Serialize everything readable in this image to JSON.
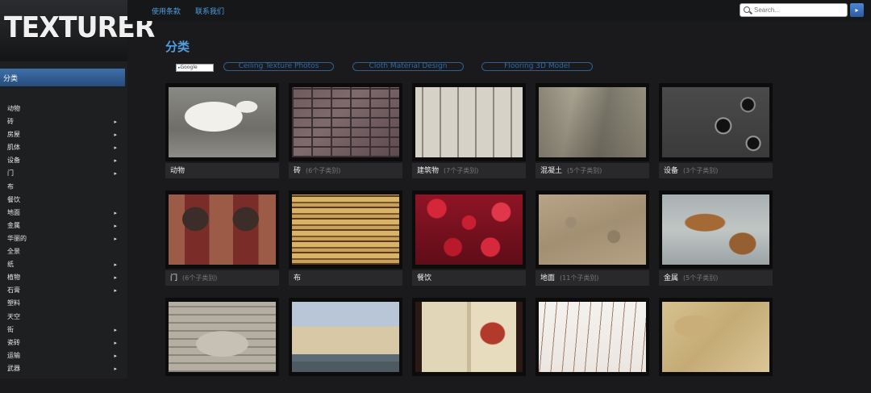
{
  "logo": {
    "text": "TEXTURER"
  },
  "topbar": {
    "links": [
      "使用条款",
      "联系我们"
    ],
    "search_placeholder": "Search..."
  },
  "sidebar": {
    "active": "分类",
    "items": [
      {
        "label": "动物",
        "arrow": false
      },
      {
        "label": "砖",
        "arrow": true
      },
      {
        "label": "房屋",
        "arrow": true
      },
      {
        "label": "肌体",
        "arrow": true
      },
      {
        "label": "设备",
        "arrow": true
      },
      {
        "label": "门",
        "arrow": true
      },
      {
        "label": "布",
        "arrow": false
      },
      {
        "label": "餐饮",
        "arrow": false
      },
      {
        "label": "地面",
        "arrow": true
      },
      {
        "label": "金属",
        "arrow": true
      },
      {
        "label": "华丽的",
        "arrow": true
      },
      {
        "label": "全景",
        "arrow": false
      },
      {
        "label": "纸",
        "arrow": true
      },
      {
        "label": "植物",
        "arrow": true
      },
      {
        "label": "石膏",
        "arrow": true
      },
      {
        "label": "塑料",
        "arrow": false
      },
      {
        "label": "天空",
        "arrow": false
      },
      {
        "label": "街",
        "arrow": true
      },
      {
        "label": "瓷砖",
        "arrow": true
      },
      {
        "label": "运输",
        "arrow": true
      },
      {
        "label": "武器",
        "arrow": true
      }
    ]
  },
  "main": {
    "title": "分类",
    "google_badge": "Google",
    "ad_pills": [
      "Ceiling Texture Photos",
      "Cloth Material Design",
      "Flooring 3D Model"
    ],
    "tiles": [
      {
        "name": "动物",
        "count": ""
      },
      {
        "name": "砖",
        "count": "(6个子类别)"
      },
      {
        "name": "建筑物",
        "count": "(7个子类别)"
      },
      {
        "name": "混凝土",
        "count": "(5个子类别)"
      },
      {
        "name": "设备",
        "count": "(3个子类别)"
      },
      {
        "name": "门",
        "count": "(6个子类别)"
      },
      {
        "name": "布",
        "count": ""
      },
      {
        "name": "餐饮",
        "count": ""
      },
      {
        "name": "地面",
        "count": "(11个子类别)"
      },
      {
        "name": "金属",
        "count": "(5个子类别)"
      },
      {
        "name": "",
        "count": ""
      },
      {
        "name": "",
        "count": ""
      },
      {
        "name": "",
        "count": ""
      },
      {
        "name": "",
        "count": ""
      },
      {
        "name": "",
        "count": ""
      }
    ]
  },
  "colors": {
    "accent": "#4f9ee0",
    "active_bg": "#2f5d96",
    "bg": "#1a1a1c"
  }
}
